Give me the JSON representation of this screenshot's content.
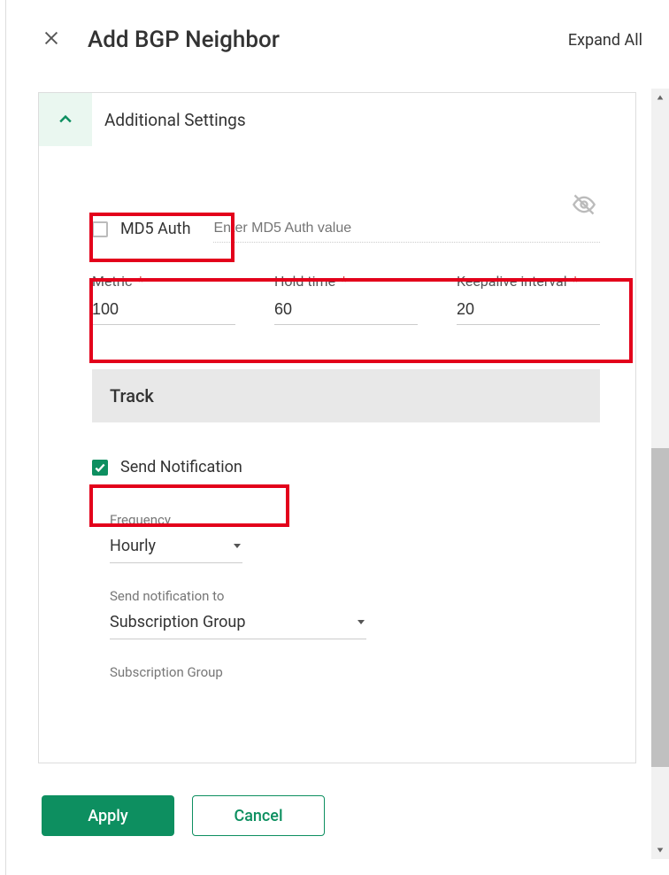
{
  "header": {
    "title": "Add BGP Neighbor",
    "expand_all": "Expand All"
  },
  "section": {
    "title": "Additional Settings"
  },
  "md5": {
    "label": "MD5 Auth",
    "checked": false,
    "placeholder": "Enter MD5 Auth value"
  },
  "fields": {
    "metric": {
      "label": "Metric",
      "value": "100"
    },
    "holdtime": {
      "label": "Hold time",
      "value": "60"
    },
    "keepalive": {
      "label": "Keepalive interval",
      "value": "20"
    }
  },
  "track": {
    "label": "Track"
  },
  "send": {
    "label": "Send Notification",
    "checked": true
  },
  "frequency": {
    "label": "Frequency",
    "value": "Hourly"
  },
  "notify_to": {
    "label": "Send notification to",
    "value": "Subscription Group"
  },
  "sub_group": {
    "label": "Subscription Group"
  },
  "footer": {
    "apply": "Apply",
    "cancel": "Cancel"
  }
}
